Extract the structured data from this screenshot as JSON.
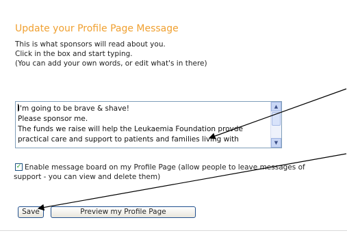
{
  "title": "Update your Profile Page Message",
  "instructions": [
    "This is what sponsors will read about you.",
    "Click in the box and start typing.",
    "(You can add your own words, or edit what's in there)"
  ],
  "message_box": {
    "lines": [
      "I'm going to be brave & shave!",
      "Please sponsor me.",
      "The funds we raise will help the Leukaemia Foundation provde",
      "practical care and support to patients and families living with"
    ],
    "scroll_up_icon": "arrow-up-icon",
    "scroll_down_icon": "arrow-down-icon"
  },
  "message_board_option": {
    "checked": true,
    "label_line1": "Enable message board on my Profile Page (allow people to leave messages of",
    "label_line2": "support - you can view and delete them)"
  },
  "buttons": {
    "save_label": "Save",
    "preview_label": "Preview my Profile Page"
  },
  "colors": {
    "title": "#f0a030",
    "button_border": "#1f4e8c",
    "checkbox_check": "#21a121"
  }
}
